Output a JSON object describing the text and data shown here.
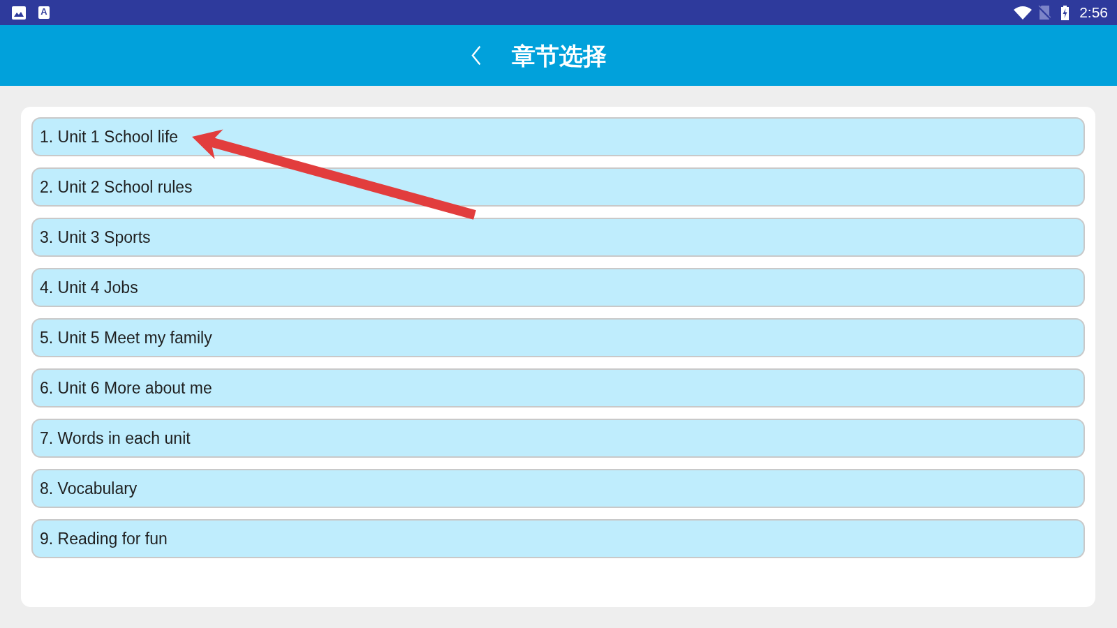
{
  "status_bar": {
    "input_method_letter": "A",
    "time": "2:56"
  },
  "header": {
    "title": "章节选择"
  },
  "chapters": [
    {
      "label": "1. Unit 1 School life"
    },
    {
      "label": "2. Unit 2 School rules"
    },
    {
      "label": "3. Unit 3 Sports"
    },
    {
      "label": "4. Unit 4 Jobs"
    },
    {
      "label": "5. Unit 5 Meet my family"
    },
    {
      "label": "6. Unit 6 More about me"
    },
    {
      "label": "7. Words in each unit"
    },
    {
      "label": "8. Vocabulary"
    },
    {
      "label": "9. Reading for fun"
    }
  ]
}
